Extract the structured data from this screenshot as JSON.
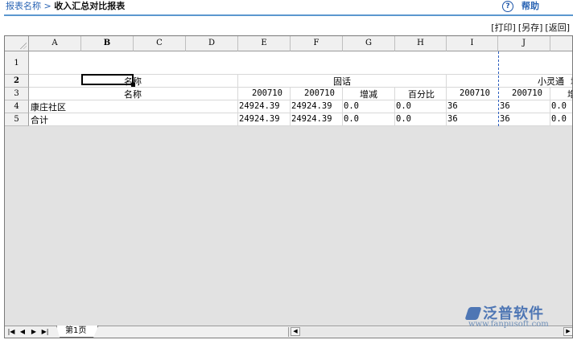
{
  "header": {
    "breadcrumb_prefix": "报表名称 >",
    "report_title": "收入汇总对比报表",
    "help_label": "帮助",
    "help_icon": "?"
  },
  "actions": {
    "print": "[打印]",
    "save_as": "[另存]",
    "back": "[返回]"
  },
  "sheet": {
    "columns": [
      "A",
      "B",
      "C",
      "D",
      "E",
      "F",
      "G",
      "H",
      "I",
      "J"
    ],
    "rows": [
      "1",
      "2",
      "3",
      "4",
      "5"
    ],
    "selected_cell": "B2",
    "cells": {
      "r2_name": "名称",
      "r2_fixed": "固话",
      "r2_phs": "小灵通",
      "r2_cut": "增",
      "r3_name": "名称",
      "r3_e": "200710",
      "r3_f": "200710",
      "r3_g": "增减",
      "r3_h": "百分比",
      "r3_i": "200710",
      "r3_j": "200710",
      "r3_k": "增",
      "r4_a": "康庄社区",
      "r4_e": "24924.39",
      "r4_f": "24924.39",
      "r4_g": "0.0",
      "r4_h": "0.0",
      "r4_i": "36",
      "r4_j": "36",
      "r4_k": "0.0",
      "r5_a": "合计",
      "r5_e": "24924.39",
      "r5_f": "24924.39",
      "r5_g": "0.0",
      "r5_h": "0.0",
      "r5_i": "36",
      "r5_j": "36",
      "r5_k": "0.0"
    },
    "tab_label": "第1页"
  },
  "watermark": {
    "brand": "泛普软件",
    "url": "www.fanpusoft.com"
  }
}
